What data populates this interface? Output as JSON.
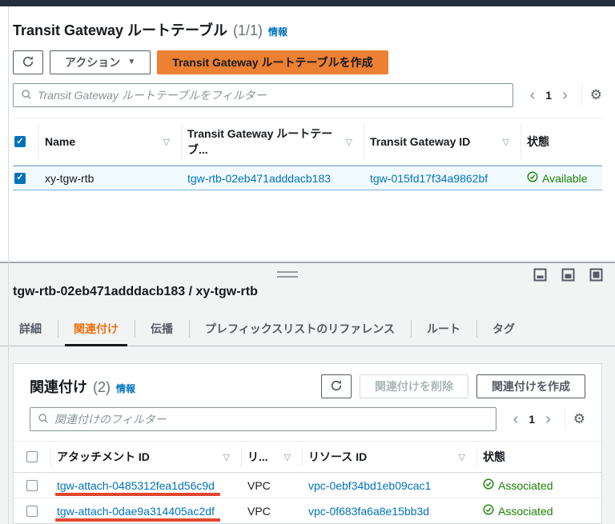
{
  "icons": {
    "sort": "▽",
    "dropdown": "▼",
    "gear": "⚙",
    "chevron_left": "‹",
    "chevron_right": "›",
    "check": "✓"
  },
  "colors": {
    "header_dark": "#232f3e",
    "accent_orange": "#ec8033",
    "active_tab_orange": "#ec7211",
    "link_blue": "#0073bb",
    "status_green": "#1d8102",
    "annotation_red": "#e2472e"
  },
  "top_panel": {
    "title": "Transit Gateway ルートテーブル",
    "count": "(1/1)",
    "info_label": "情報",
    "actions_button": "アクション",
    "create_button": "Transit Gateway ルートテーブルを作成",
    "filter_placeholder": "Transit Gateway ルートテーブルをフィルター",
    "page_number": "1",
    "table": {
      "headers": {
        "name": "Name",
        "rtb_name": "Transit Gateway ルートテーブ...",
        "tgw_id": "Transit Gateway ID",
        "status": "状態"
      },
      "rows": [
        {
          "name": "xy-tgw-rtb",
          "rtb_id": "tgw-rtb-02eb471adddacb183",
          "tgw_id": "tgw-015fd17f34a9862bf",
          "status": "Available"
        }
      ]
    }
  },
  "detail_panel": {
    "title": "tgw-rtb-02eb471adddacb183 / xy-tgw-rtb",
    "tabs": [
      "詳細",
      "関連付け",
      "伝播",
      "プレフィックスリストのリファレンス",
      "ルート",
      "タグ"
    ],
    "associations": {
      "title": "関連付け",
      "count": "(2)",
      "info_label": "情報",
      "delete_button": "関連付けを削除",
      "create_button": "関連付けを作成",
      "filter_placeholder": "関連付けのフィルター",
      "page_number": "1",
      "table": {
        "headers": {
          "attachment_id": "アタッチメント ID",
          "resource_type": "リ...",
          "resource_id": "リソース ID",
          "status": "状態"
        },
        "rows": [
          {
            "attachment_id": "tgw-attach-0485312fea1d56c9d",
            "resource_type": "VPC",
            "resource_id": "vpc-0ebf34bd1eb09cac1",
            "status": "Associated"
          },
          {
            "attachment_id": "tgw-attach-0dae9a314405ac2df",
            "resource_type": "VPC",
            "resource_id": "vpc-0f683fa6a8e15bb3d",
            "status": "Associated"
          }
        ]
      }
    }
  }
}
